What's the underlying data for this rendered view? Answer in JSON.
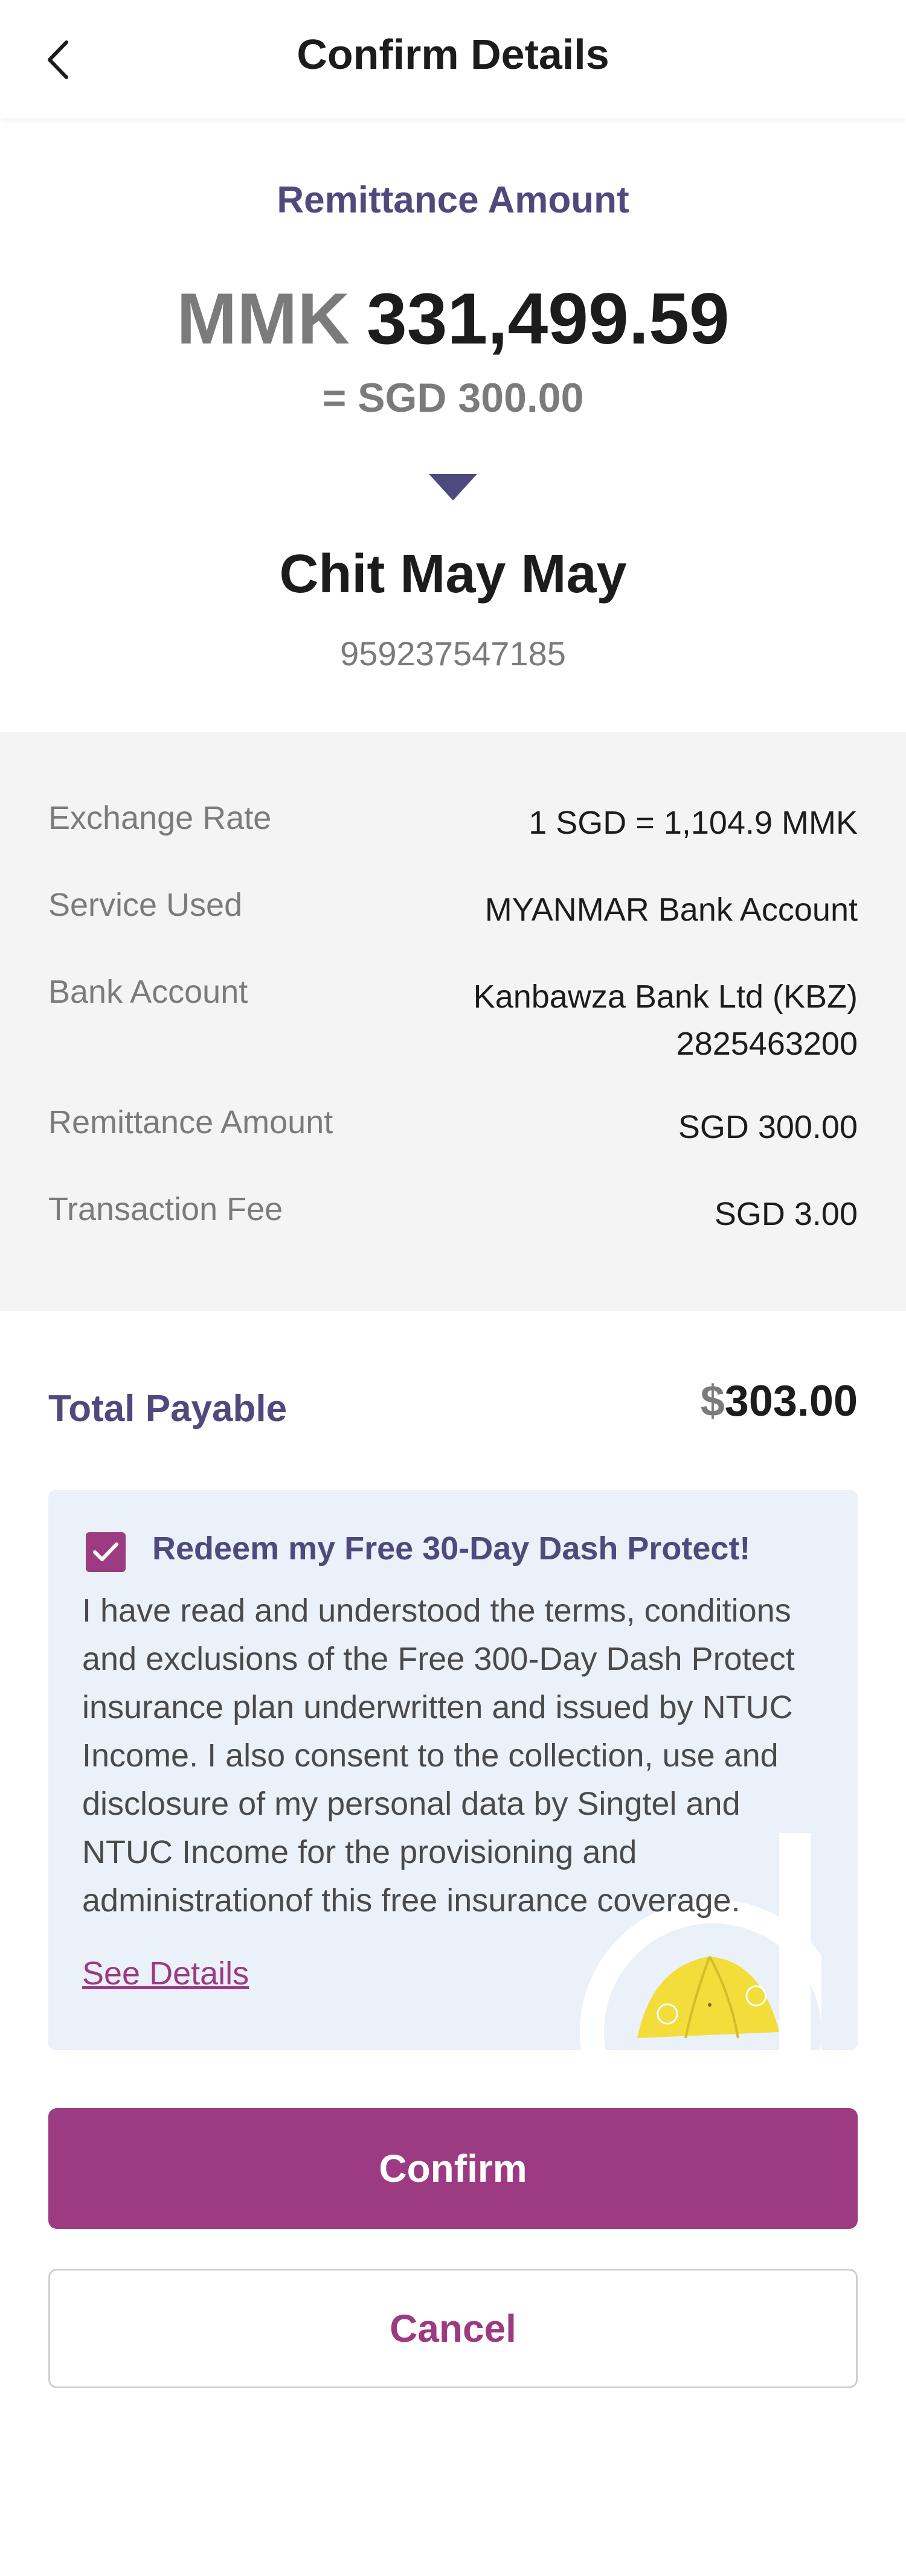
{
  "header": {
    "title": "Confirm Details",
    "back_icon": "chevron-left-icon"
  },
  "summary": {
    "label": "Remittance Amount",
    "currency": "MMK",
    "amount": "331,499.59",
    "equivalent": "= SGD 300.00",
    "recipient_name": "Chit May May",
    "recipient_phone": "959237547185"
  },
  "details": [
    {
      "label": "Exchange Rate",
      "value": "1 SGD = 1,104.9 MMK"
    },
    {
      "label": "Service Used",
      "value": "MYANMAR Bank Account"
    },
    {
      "label": "Bank Account",
      "value": "Kanbawza Bank Ltd (KBZ)",
      "value2": "2825463200"
    },
    {
      "label": "Remittance Amount",
      "value": "SGD 300.00"
    },
    {
      "label": "Transaction Fee",
      "value": "SGD 3.00"
    }
  ],
  "total": {
    "label": "Total Payable",
    "symbol": "$",
    "value": "303.00"
  },
  "insurance": {
    "checked": true,
    "title": "Redeem my Free 30-Day Dash Protect!",
    "text": "I have read and understood the terms, conditions and exclusions of the Free 300-Day Dash Protect insurance plan underwritten and issued by NTUC Income. I also consent to the collection, use and disclosure of my personal data by Singtel and NTUC Income for the provisioning and administrationof this free insurance coverage.",
    "link": "See Details"
  },
  "buttons": {
    "confirm": "Confirm",
    "cancel": "Cancel"
  },
  "colors": {
    "accent": "#9c3a82",
    "heading": "#4f4a7d",
    "panel": "#f4f4f4",
    "card": "#eaf1f8"
  }
}
